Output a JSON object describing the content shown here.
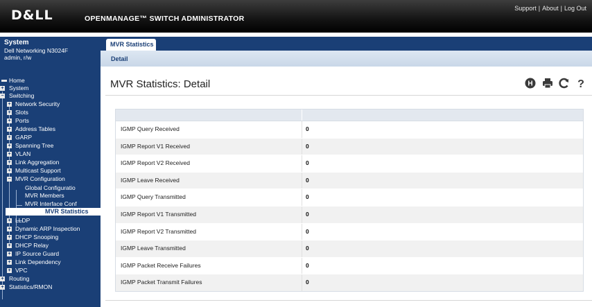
{
  "header": {
    "logo": "D&LL",
    "app_title": "OPENMANAGE™ SWITCH ADMINISTRATOR",
    "links": [
      "Support",
      "About",
      "Log Out"
    ],
    "separator": "|"
  },
  "system": {
    "title": "System",
    "model": "Dell Networking N3024F",
    "user": "admin, r/w"
  },
  "nav": {
    "home": "Home",
    "system": "System",
    "switching": "Switching",
    "network_security": "Network Security",
    "slots": "Slots",
    "ports": "Ports",
    "address_tables": "Address Tables",
    "garp": "GARP",
    "spanning_tree": "Spanning Tree",
    "vlan": "VLAN",
    "link_aggregation": "Link Aggregation",
    "multicast_support": "Multicast Support",
    "mvr_configuration": "MVR Configuration",
    "global_configuration": "Global Configuratio",
    "mvr_members": "MVR Members",
    "mvr_interface_conf": "MVR Interface Conf",
    "mvr_statistics": "MVR Statistics",
    "lldp": "LLDP",
    "dynamic_arp": "Dynamic ARP Inspection",
    "dhcp_snooping": "DHCP Snooping",
    "dhcp_relay": "DHCP Relay",
    "ip_source_guard": "IP Source Guard",
    "link_dependency": "Link Dependency",
    "vpc": "VPC",
    "routing": "Routing",
    "statistics_rmon": "Statistics/RMON"
  },
  "tabs": {
    "main": "MVR Statistics",
    "sub": "Detail"
  },
  "page": {
    "title": "MVR Statistics: Detail"
  },
  "tools": {
    "save_icon_label": "H",
    "print_icon_label": "⎙",
    "refresh_icon_label": "C",
    "help_icon_label": "?"
  },
  "table": {
    "rows": [
      {
        "label": "IGMP Query Received",
        "value": "0"
      },
      {
        "label": "IGMP Report V1 Received",
        "value": "0"
      },
      {
        "label": "IGMP Report V2 Received",
        "value": "0"
      },
      {
        "label": "IGMP Leave Received",
        "value": "0"
      },
      {
        "label": "IGMP Query Transmitted",
        "value": "0"
      },
      {
        "label": "IGMP Report V1 Transmitted",
        "value": "0"
      },
      {
        "label": "IGMP Report V2 Transmitted",
        "value": "0"
      },
      {
        "label": "IGMP Leave Transmitted",
        "value": "0"
      },
      {
        "label": "IGMP Packet Receive Failures",
        "value": "0"
      },
      {
        "label": "IGMP Packet Transmit Failures",
        "value": "0"
      }
    ]
  },
  "colors": {
    "nav_bg": "#1a3f76",
    "header_bg": "#141414",
    "subtab_bg": "#dde7f2"
  }
}
